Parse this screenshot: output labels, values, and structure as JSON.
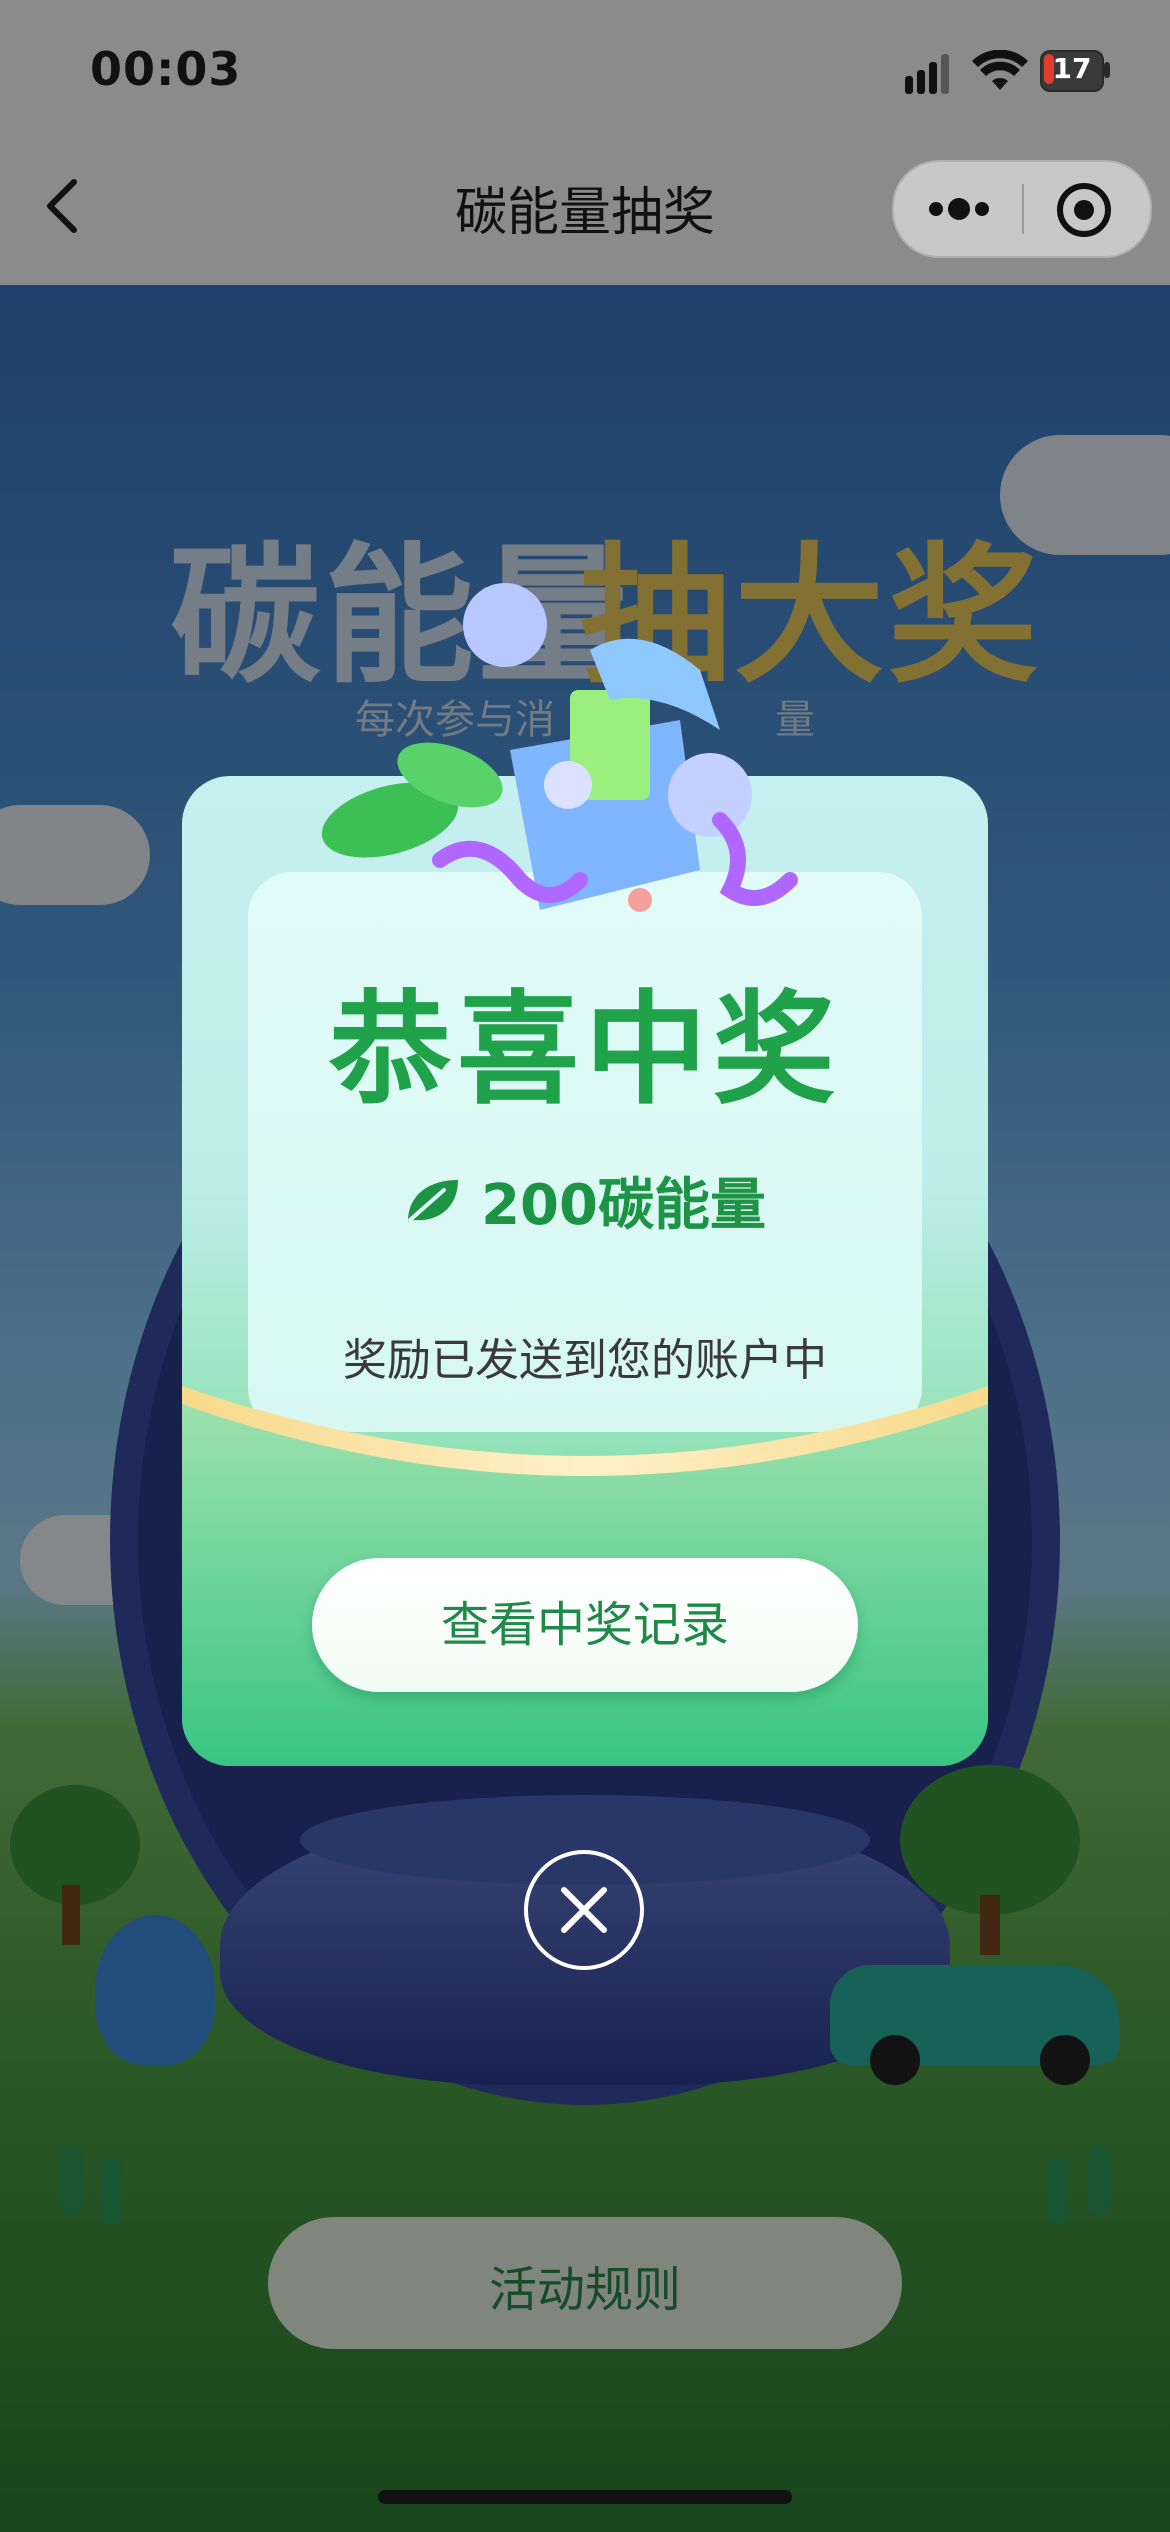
{
  "status_bar": {
    "time": "00:03",
    "battery": "17"
  },
  "nav": {
    "title": "碳能量抽奖",
    "back_icon": "chevron-left-icon",
    "more_icon": "more-dots-icon",
    "close_miniprogram_icon": "target-icon"
  },
  "background": {
    "title_part1": "碳能量",
    "title_part2": "抽大奖",
    "subtitle": "每次参与消",
    "subtitle_end": "量",
    "rules_button": "活动规则"
  },
  "modal": {
    "title": "恭喜中奖",
    "reward": "200碳能量",
    "reward_icon": "leaf-icon",
    "description": "奖励已发送到您的账户中",
    "button": "查看中奖记录",
    "close_icon": "close-circle-icon"
  },
  "colors": {
    "accent": "#1fa24a",
    "modal_top": "#c6efef",
    "modal_bottom": "#39c483"
  }
}
